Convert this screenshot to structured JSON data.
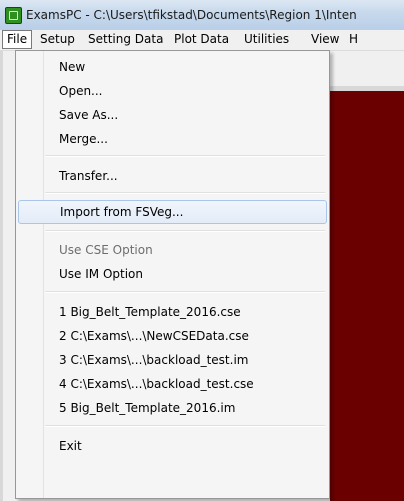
{
  "window": {
    "title": "ExamsPC - C:\\Users\\tfikstad\\Documents\\Region 1\\Inten"
  },
  "menubar": {
    "items": [
      "File",
      "Setup",
      "Setting Data",
      "Plot Data",
      "Utilities",
      "View",
      "H"
    ]
  },
  "file_menu": {
    "new": "New",
    "open": "Open...",
    "save_as": "Save As...",
    "merge": "Merge...",
    "transfer": "Transfer...",
    "import_fsveg": "Import from FSVeg...",
    "use_cse_option": "Use CSE Option",
    "use_im_option": "Use IM Option",
    "recent_files": [
      "1 Big_Belt_Template_2016.cse",
      "2 C:\\Exams\\...\\NewCSEData.cse",
      "3 C:\\Exams\\...\\backload_test.im",
      "4 C:\\Exams\\...\\backload_test.cse",
      "5 Big_Belt_Template_2016.im"
    ],
    "exit": "Exit"
  },
  "colors": {
    "background_panel": "#6b0000",
    "hover_highlight": "#e3ecf8"
  }
}
